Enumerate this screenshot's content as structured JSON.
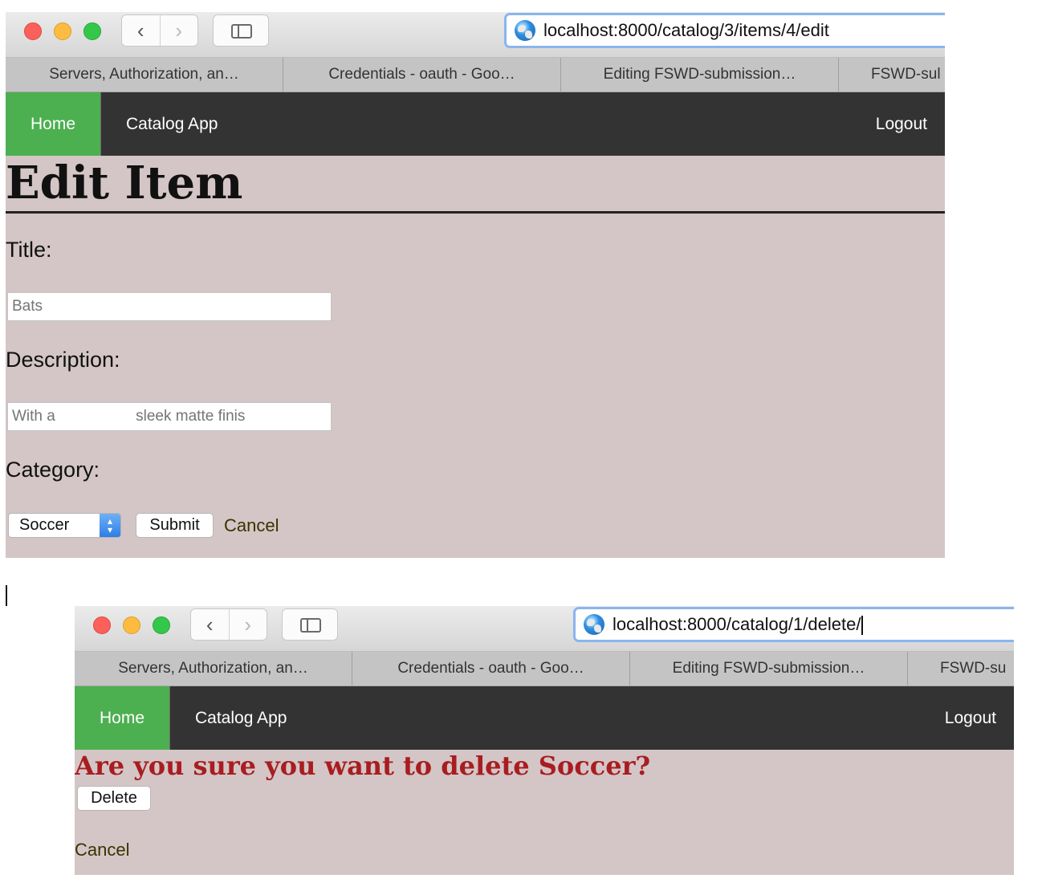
{
  "windows": [
    {
      "url": "localhost:8000/catalog/3/items/4/edit",
      "tabs": [
        "Servers, Authorization, an…",
        "Credentials - oauth - Goo…",
        "Editing FSWD-submission…",
        "FSWD-sul"
      ],
      "nav": {
        "home": "Home",
        "title": "Catalog App",
        "logout": "Logout"
      },
      "heading": "Edit Item",
      "form": {
        "title_label": "Title:",
        "title_value": "Bats",
        "description_label": "Description:",
        "description_value": "With a                   sleek matte finis",
        "category_label": "Category:",
        "category_selected": "Soccer",
        "submit_label": "Submit",
        "cancel_label": "Cancel"
      }
    },
    {
      "url": "localhost:8000/catalog/1/delete/",
      "tabs": [
        "Servers, Authorization, an…",
        "Credentials - oauth - Goo…",
        "Editing FSWD-submission…",
        "FSWD-su"
      ],
      "nav": {
        "home": "Home",
        "title": "Catalog App",
        "logout": "Logout"
      },
      "heading": "Are you sure you want to delete Soccer?",
      "delete_label": "Delete",
      "cancel_label": "Cancel"
    }
  ],
  "colors": {
    "nav_bg": "#333333",
    "home_active": "#4caf50",
    "page_bg": "#d4c6c6",
    "warning_heading": "#a81d21",
    "url_focus": "#8ab5ee"
  }
}
